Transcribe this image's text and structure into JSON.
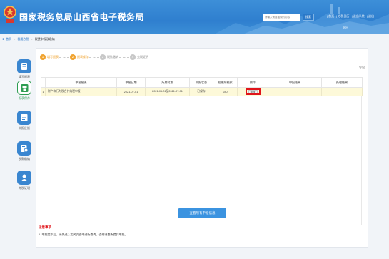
{
  "header": {
    "title": "国家税务总局山西省电子税务局",
    "search_placeholder": "请输入需要搜索的内容",
    "search_button": "搜索",
    "links": [
      "| 首页",
      "| 办税日历",
      "| 退出系统",
      "| 退出"
    ],
    "user": "退出",
    "colors": {
      "bg": "#2f7fcf",
      "text": "#ffffff"
    }
  },
  "breadcrumb": {
    "items": [
      "首页",
      "我要办税",
      "税费申报及缴纳"
    ]
  },
  "sidebar": {
    "items": [
      {
        "label": "填写报表",
        "icon": "form-icon",
        "active": false
      },
      {
        "label": "报表保存",
        "icon": "save-icon",
        "active": true
      },
      {
        "label": "申报反馈",
        "icon": "feedback-icon",
        "active": false
      },
      {
        "label": "税款缴纳",
        "icon": "payment-icon",
        "active": false
      },
      {
        "label": "完税证明",
        "icon": "certificate-icon",
        "active": false
      }
    ]
  },
  "steps": [
    {
      "num": "1",
      "label": "填写报表",
      "state": "done"
    },
    {
      "num": "2",
      "label": "报表保存",
      "state": "current"
    },
    {
      "num": "3",
      "label": "税款缴纳",
      "state": "pending"
    },
    {
      "num": "4",
      "label": "完税证明",
      "state": "pending"
    }
  ],
  "export_label": "导出",
  "table": {
    "columns": [
      "申报报表",
      "申报日期",
      "所属时期",
      "申报状态",
      "应缴纳税款",
      "操作",
      "申报结果",
      "处理结果"
    ],
    "rows": [
      {
        "index": "1",
        "name": "财产和行为税合并纳税申报",
        "date": "2021-07-01",
        "period": "2021-06-01至2021-07-01",
        "status": "已保存",
        "amount": "280",
        "action": "申报",
        "result": "",
        "handle": ""
      }
    ]
  },
  "submit_button": "查看所有申报信息",
  "notice": {
    "title": "注意事项",
    "text": "1. 申报完毕后，请先进入相关页面中进行查询，否则请重新提交申报。"
  }
}
